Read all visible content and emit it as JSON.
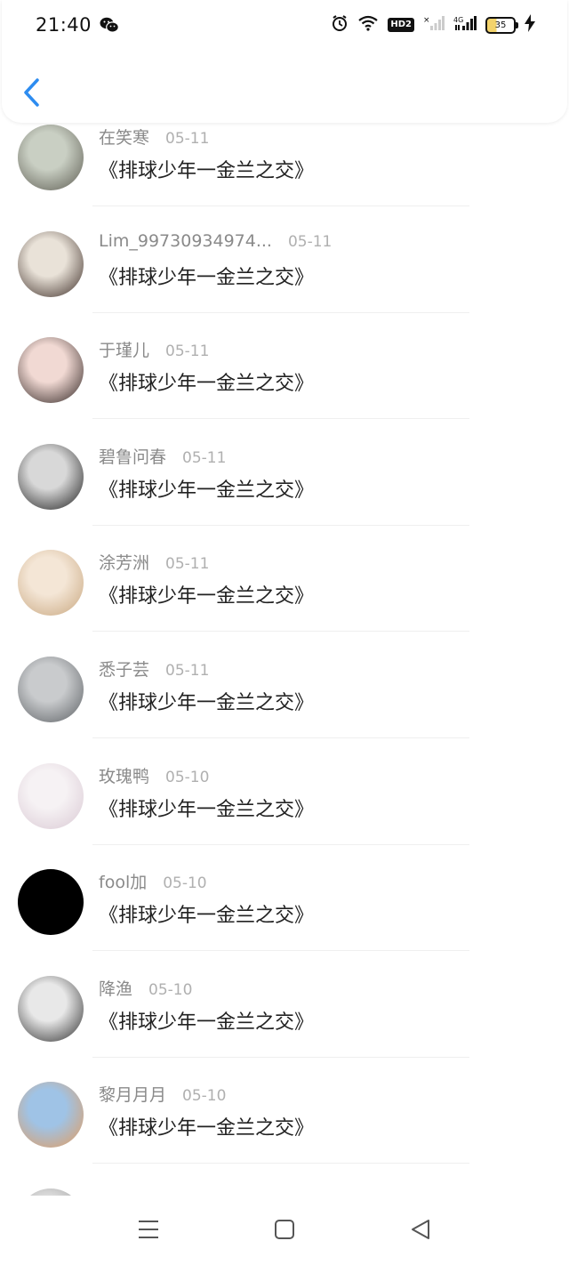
{
  "status": {
    "time": "21:40",
    "battery": "35"
  },
  "comments": [
    {
      "name": "在笑寒",
      "date": "05-11",
      "text": "《排球少年一金兰之交》",
      "avatar_colors": [
        "#c9cfc3",
        "#5b5a50"
      ]
    },
    {
      "name": "Lim_99730934974...",
      "date": "05-11",
      "text": "《排球少年一金兰之交》",
      "avatar_colors": [
        "#e9e2d8",
        "#3a2a24"
      ]
    },
    {
      "name": "于瑾儿",
      "date": "05-11",
      "text": "《排球少年一金兰之交》",
      "avatar_colors": [
        "#f1d9d3",
        "#2d2220"
      ]
    },
    {
      "name": "碧鲁问春",
      "date": "05-11",
      "text": "《排球少年一金兰之交》",
      "avatar_colors": [
        "#d8d8d8",
        "#1b1b1b"
      ]
    },
    {
      "name": "涂芳洲",
      "date": "05-11",
      "text": "《排球少年一金兰之交》",
      "avatar_colors": [
        "#f4e6d6",
        "#c7a57d"
      ]
    },
    {
      "name": "悉子芸",
      "date": "05-11",
      "text": "《排球少年一金兰之交》",
      "avatar_colors": [
        "#c9cbcd",
        "#5a5e62"
      ]
    },
    {
      "name": "玫瑰鸭",
      "date": "05-10",
      "text": "《排球少年一金兰之交》",
      "avatar_colors": [
        "#f6f2f4",
        "#d9c8d3"
      ]
    },
    {
      "name": "fool加",
      "date": "05-10",
      "text": "《排球少年一金兰之交》",
      "avatar_colors": [
        "#000000",
        "#000000"
      ]
    },
    {
      "name": "降渔",
      "date": "05-10",
      "text": "《排球少年一金兰之交》",
      "avatar_colors": [
        "#e8e8e8",
        "#2b2b2b"
      ]
    },
    {
      "name": "黎月月月",
      "date": "05-10",
      "text": "《排球少年一金兰之交》",
      "avatar_colors": [
        "#9fc3e6",
        "#e69b5a"
      ]
    },
    {
      "name": "",
      "date": "",
      "text": "",
      "avatar_colors": [
        "#dddddd",
        "#888888"
      ]
    }
  ],
  "icons": {
    "back": "chevron-left-icon",
    "menu": "menu-icon",
    "home": "home-square-icon",
    "back_nav": "back-triangle-icon"
  },
  "colors": {
    "accent": "#2d8cf0",
    "name": "#8a8a8a",
    "date": "#b0b0b0",
    "text": "#222222"
  }
}
